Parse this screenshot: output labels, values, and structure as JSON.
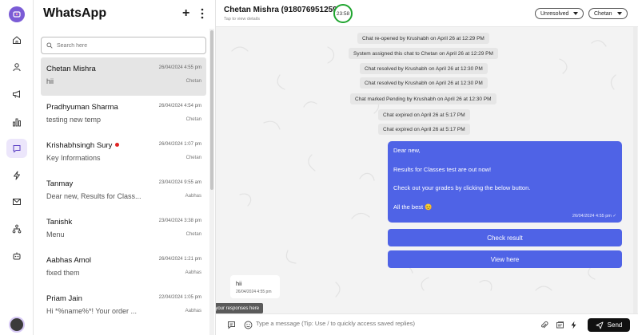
{
  "app": {
    "title": "WhatsApp"
  },
  "colors": {
    "accent": "#4f63e6",
    "timer_ring": "#1fa52f",
    "unread_dot": "#e02424",
    "rail_active": "#ece6fb"
  },
  "rail": {
    "items": [
      {
        "name": "home-icon"
      },
      {
        "name": "user-icon"
      },
      {
        "name": "megaphone-icon"
      },
      {
        "name": "bar-chart-icon"
      },
      {
        "name": "chat-bubble-icon"
      },
      {
        "name": "lightning-icon"
      },
      {
        "name": "mail-icon"
      },
      {
        "name": "flow-icon"
      },
      {
        "name": "bot-icon"
      }
    ],
    "active_index": 4
  },
  "search": {
    "placeholder": "Search here"
  },
  "chats": [
    {
      "name": "Chetan Mishra",
      "time": "26/04/2024 4:55 pm",
      "preview": "hii",
      "agent": "Chetan",
      "selected": true,
      "unread": false
    },
    {
      "name": "Pradhyuman Sharma",
      "time": "26/04/2024 4:54 pm",
      "preview": "testing new temp",
      "agent": "Chetan",
      "selected": false,
      "unread": false
    },
    {
      "name": "Krishabhsingh Sury",
      "time": "26/04/2024 1:07 pm",
      "preview": "Key Informations",
      "agent": "Chetan",
      "selected": false,
      "unread": true
    },
    {
      "name": "Tanmay",
      "time": "23/04/2024 9:55 am",
      "preview": "Dear new, Results for Class...",
      "agent": "Aabhas",
      "selected": false,
      "unread": false
    },
    {
      "name": "Tanishk",
      "time": "23/04/2024 3:38 pm",
      "preview": "Menu",
      "agent": "Chetan",
      "selected": false,
      "unread": false
    },
    {
      "name": "Aabhas Amol",
      "time": "26/04/2024 1:21 pm",
      "preview": "fixed them",
      "agent": "Aabhas",
      "selected": false,
      "unread": false
    },
    {
      "name": "Priam Jain",
      "time": "22/04/2024 1:05 pm",
      "preview": "Hi *%name%*! Your order ...",
      "agent": "Aabhas",
      "selected": false,
      "unread": false
    }
  ],
  "conversation": {
    "contact_name": "Chetan Mishra (918076951259)",
    "contact_sub": "Tap to view details",
    "timer": "23:58",
    "status_dropdown": "Unresolved",
    "agent_dropdown": "Chetan",
    "system_messages": [
      "Chat re-opened by Krushabh on April 26 at 12:29 PM",
      "System assigned this chat to Chetan on April 26 at 12:29 PM",
      "Chat resolved by Krushabh on April 26 at 12:30 PM",
      "Chat resolved by Krushabh on April 26 at 12:30 PM",
      "Chat marked Pending by Krushabh on April 26 at 12:30 PM",
      "Chat expired on April 26 at 5:17 PM",
      "Chat expired on April 26 at 5:17 PM"
    ],
    "outgoing": {
      "lines": [
        "Dear new,",
        "Results for Classes test are out now!",
        "Check out your grades by clicking the below button.",
        "All the best 😊"
      ],
      "timestamp": "26/04/2024 4:55 pm ✓"
    },
    "buttons": [
      "Check result",
      "View here"
    ],
    "incoming": {
      "text": "hii",
      "timestamp": "26/04/2024 4:55 pm"
    },
    "tooltip": "Save your responses here",
    "composer_placeholder": "Type a message (Tip: Use / to quickly access saved replies)",
    "send_label": "Send"
  }
}
